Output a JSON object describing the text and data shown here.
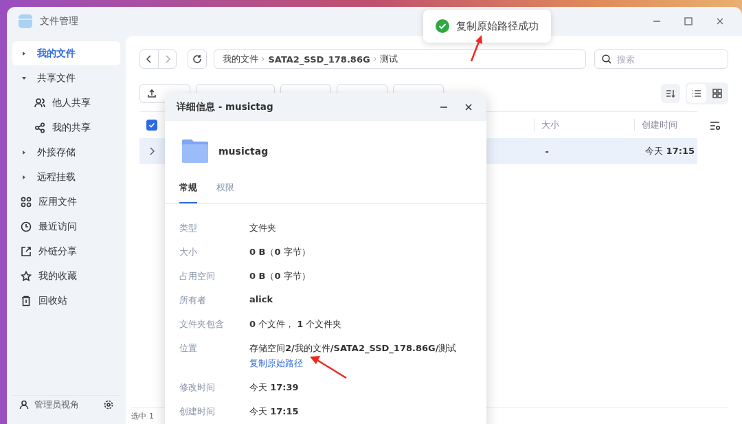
{
  "window": {
    "title": "文件管理"
  },
  "sidebar": {
    "items": [
      {
        "label": "我的文件",
        "selected": true,
        "expanded": false
      },
      {
        "label": "共享文件",
        "selected": false,
        "expanded": true,
        "children": [
          {
            "label": "他人共享",
            "selected": false
          },
          {
            "label": "我的共享",
            "selected": false
          }
        ]
      },
      {
        "label": "外接存储",
        "selected": false,
        "expanded": false
      },
      {
        "label": "远程挂载",
        "selected": false,
        "expanded": false
      },
      {
        "label": "应用文件",
        "selected": false
      },
      {
        "label": "最近访问",
        "selected": false
      },
      {
        "label": "外链分享",
        "selected": false
      },
      {
        "label": "我的收藏",
        "selected": false
      },
      {
        "label": "回收站",
        "selected": false
      }
    ],
    "footer": {
      "label": "管理员视角"
    }
  },
  "breadcrumb": [
    {
      "label": "我的文件",
      "bold": false
    },
    {
      "label": "SATA2_SSD_178.86G",
      "bold": true
    },
    {
      "label": "测试",
      "bold": false
    }
  ],
  "search": {
    "placeholder": "搜索"
  },
  "table": {
    "header_checked": true,
    "columns": [
      {
        "label": "大小"
      },
      {
        "label": "创建时间"
      }
    ],
    "rows": [
      {
        "selected": true,
        "size": "-",
        "created": "今天 **17:15**"
      }
    ]
  },
  "status_bar": {
    "text": "选中 1"
  },
  "toast": {
    "text": "复制原始路径成功"
  },
  "dialog": {
    "title": "详细信息 - musictag",
    "name": "musictag",
    "tabs": [
      {
        "label": "常规",
        "selected": true
      },
      {
        "label": "权限",
        "selected": false
      }
    ],
    "fields": [
      {
        "label": "类型",
        "value": "文件夹"
      },
      {
        "label": "大小",
        "value": "**0 B**（**0** 字节）"
      },
      {
        "label": "占用空间",
        "value": "**0 B**（**0** 字节）"
      },
      {
        "label": "所有者",
        "value": "**alick**"
      },
      {
        "label": "文件夹包含",
        "value": "**0** 个文件， **1** 个文件夹"
      },
      {
        "label": "位置",
        "value": "存储空间**2/**我的文件**/SATA2_SSD_178.86G/**测试",
        "link": "复制原始路径"
      },
      {
        "label": "修改时间",
        "value": "今天 **17:39**"
      },
      {
        "label": "创建时间",
        "value": "今天 **17:15**"
      }
    ]
  }
}
